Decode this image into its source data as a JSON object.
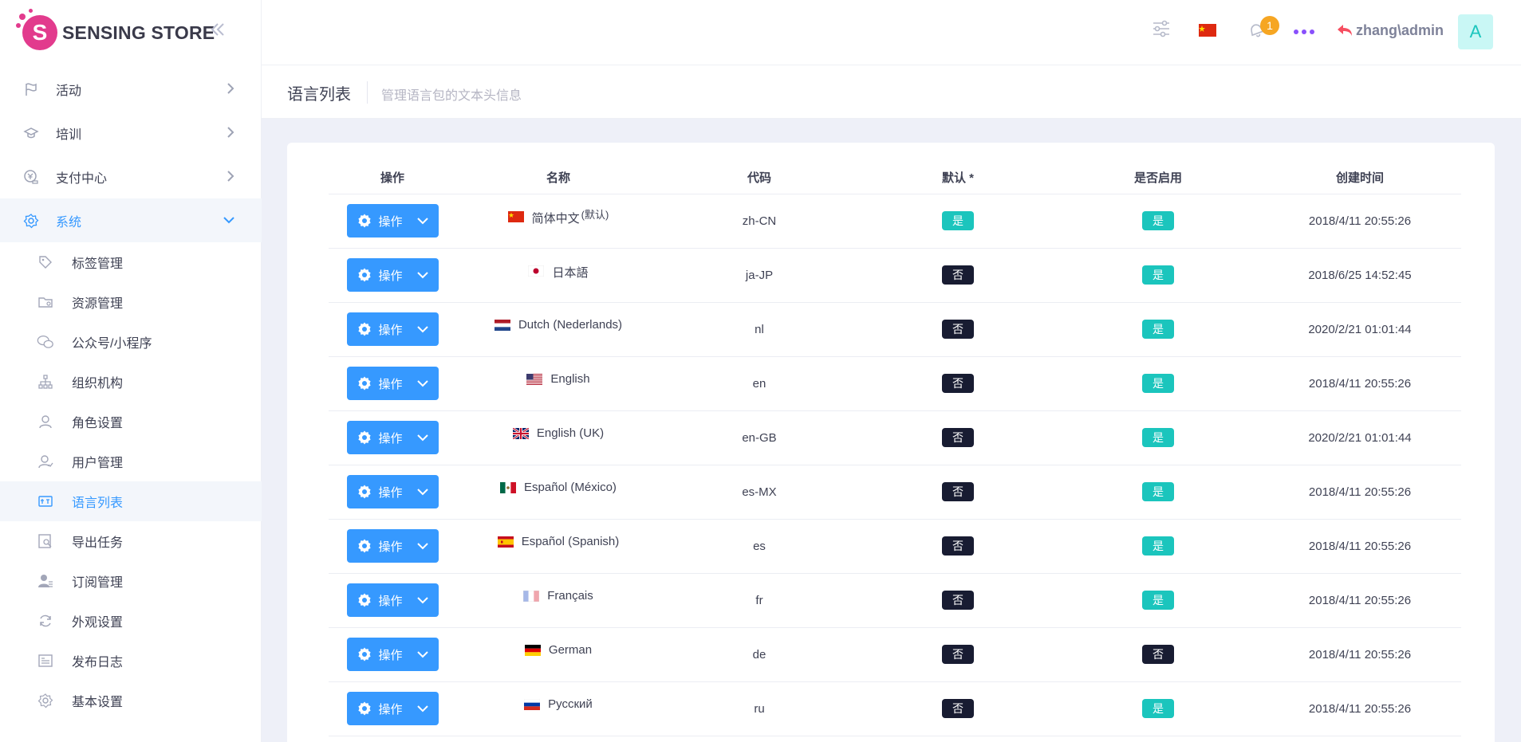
{
  "brand": {
    "name": "SENSING STORE",
    "logo_letter": "S"
  },
  "sidebar": {
    "menu": [
      {
        "label": "活动",
        "icon": "flag-icon"
      },
      {
        "label": "培训",
        "icon": "graduation-cap-icon"
      },
      {
        "label": "支付中心",
        "icon": "payment-icon"
      },
      {
        "label": "系统",
        "icon": "gear-icon"
      }
    ],
    "sub_items": [
      {
        "label": "标签管理",
        "icon": "tag-icon"
      },
      {
        "label": "资源管理",
        "icon": "folder-icon"
      },
      {
        "label": "公众号/小程序",
        "icon": "wechat-icon"
      },
      {
        "label": "组织机构",
        "icon": "org-chart-icon"
      },
      {
        "label": "角色设置",
        "icon": "user-icon"
      },
      {
        "label": "用户管理",
        "icon": "users-icon"
      },
      {
        "label": "语言列表",
        "icon": "language-icon"
      },
      {
        "label": "导出任务",
        "icon": "export-icon"
      },
      {
        "label": "订阅管理",
        "icon": "subscription-icon"
      },
      {
        "label": "外观设置",
        "icon": "refresh-icon"
      },
      {
        "label": "发布日志",
        "icon": "log-icon"
      },
      {
        "label": "基本设置",
        "icon": "settings-icon"
      }
    ]
  },
  "header": {
    "notification_count": "1",
    "user": "zhang\\admin",
    "avatar_letter": "A"
  },
  "subheader": {
    "title": "语言列表",
    "description": "管理语言包的文本头信息"
  },
  "table": {
    "columns": [
      "操作",
      "名称",
      "代码",
      "默认 *",
      "是否启用",
      "创建时间"
    ],
    "op_label": "操作",
    "default_suffix": "(默认)",
    "rows": [
      {
        "flag": "cn",
        "name": "简体中文",
        "default_mark": true,
        "code": "zh-CN",
        "is_default": "是",
        "enabled": "是",
        "created": "2018/4/11 20:55:26"
      },
      {
        "flag": "jp",
        "name": "日本語",
        "default_mark": false,
        "code": "ja-JP",
        "is_default": "否",
        "enabled": "是",
        "created": "2018/6/25 14:52:45"
      },
      {
        "flag": "nl",
        "name": "Dutch (Nederlands)",
        "default_mark": false,
        "code": "nl",
        "is_default": "否",
        "enabled": "是",
        "created": "2020/2/21 01:01:44"
      },
      {
        "flag": "us",
        "name": "English",
        "default_mark": false,
        "code": "en",
        "is_default": "否",
        "enabled": "是",
        "created": "2018/4/11 20:55:26"
      },
      {
        "flag": "gb",
        "name": "English (UK)",
        "default_mark": false,
        "code": "en-GB",
        "is_default": "否",
        "enabled": "是",
        "created": "2020/2/21 01:01:44"
      },
      {
        "flag": "mx",
        "name": "Español (México)",
        "default_mark": false,
        "code": "es-MX",
        "is_default": "否",
        "enabled": "是",
        "created": "2018/4/11 20:55:26"
      },
      {
        "flag": "es",
        "name": "Español (Spanish)",
        "default_mark": false,
        "code": "es",
        "is_default": "否",
        "enabled": "是",
        "created": "2018/4/11 20:55:26"
      },
      {
        "flag": "fr",
        "name": "Français",
        "default_mark": false,
        "code": "fr",
        "is_default": "否",
        "enabled": "是",
        "created": "2018/4/11 20:55:26"
      },
      {
        "flag": "de",
        "name": "German",
        "default_mark": false,
        "code": "de",
        "is_default": "否",
        "enabled": "否",
        "created": "2018/4/11 20:55:26"
      },
      {
        "flag": "ru",
        "name": "Русский",
        "default_mark": false,
        "code": "ru",
        "is_default": "否",
        "enabled": "是",
        "created": "2018/4/11 20:55:26"
      }
    ]
  },
  "colors": {
    "primary": "#3699ff",
    "success": "#1bc5bd",
    "dark": "#181c32",
    "warning": "#f6a623",
    "brand": "#e23b8d"
  }
}
